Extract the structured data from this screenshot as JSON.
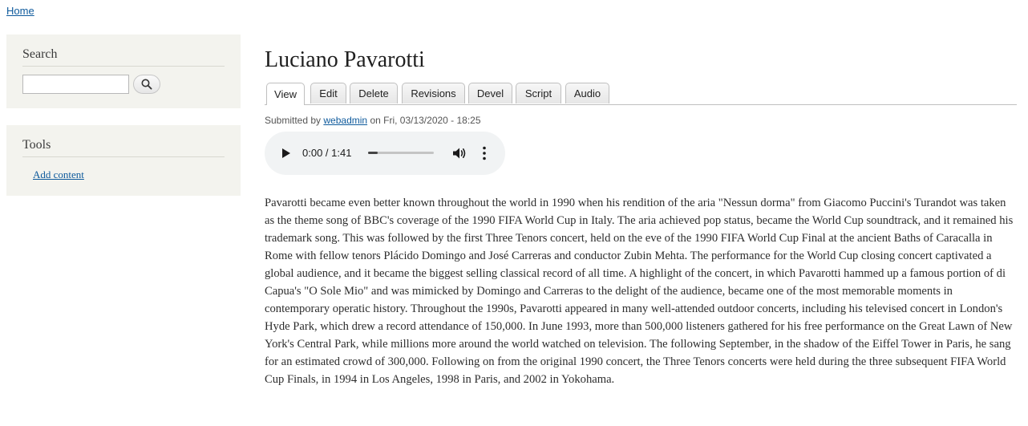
{
  "breadcrumb": {
    "home": "Home"
  },
  "sidebar": {
    "search": {
      "title": "Search",
      "placeholder": "",
      "value": ""
    },
    "tools": {
      "title": "Tools",
      "add_content": "Add content"
    }
  },
  "main": {
    "title": "Luciano Pavarotti",
    "tabs": [
      {
        "label": "View",
        "active": true
      },
      {
        "label": "Edit",
        "active": false
      },
      {
        "label": "Delete",
        "active": false
      },
      {
        "label": "Revisions",
        "active": false
      },
      {
        "label": "Devel",
        "active": false
      },
      {
        "label": "Script",
        "active": false
      },
      {
        "label": "Audio",
        "active": false
      }
    ],
    "submitted": {
      "prefix": "Submitted by",
      "author": "webadmin",
      "date": "on Fri, 03/13/2020 - 18:25"
    },
    "audio": {
      "time": "0:00 / 1:41",
      "progress_fraction": 0.15,
      "play_icon": "play-icon",
      "volume_icon": "volume-icon",
      "more_icon": "more-options-icon"
    },
    "body": "Pavarotti became even better known throughout the world in 1990 when his rendition of the aria \"Nessun dorma\" from Giacomo Puccini's Turandot was taken as the theme song of BBC's coverage of the 1990 FIFA World Cup in Italy. The aria achieved pop status, became the World Cup soundtrack, and it remained his trademark song. This was followed by the first Three Tenors concert, held on the eve of the 1990 FIFA World Cup Final at the ancient Baths of Caracalla in Rome with fellow tenors Plácido Domingo and José Carreras and conductor Zubin Mehta. The performance for the World Cup closing concert captivated a global audience, and it became the biggest selling classical record of all time. A highlight of the concert, in which Pavarotti hammed up a famous portion of di Capua's \"O Sole Mio\" and was mimicked by Domingo and Carreras to the delight of the audience, became one of the most memorable moments in contemporary operatic history. Throughout the 1990s, Pavarotti appeared in many well-attended outdoor concerts, including his televised concert in London's Hyde Park, which drew a record attendance of 150,000. In June 1993, more than 500,000 listeners gathered for his free performance on the Great Lawn of New York's Central Park, while millions more around the world watched on television. The following September, in the shadow of the Eiffel Tower in Paris, he sang for an estimated crowd of 300,000. Following on from the original 1990 concert, the Three Tenors concerts were held during the three subsequent FIFA World Cup Finals, in 1994 in Los Angeles, 1998 in Paris, and 2002 in Yokohama."
  },
  "colors": {
    "link": "#0e5a9c",
    "sidebar_bg": "#f3f3ee",
    "player_bg": "#f1f3f4"
  }
}
